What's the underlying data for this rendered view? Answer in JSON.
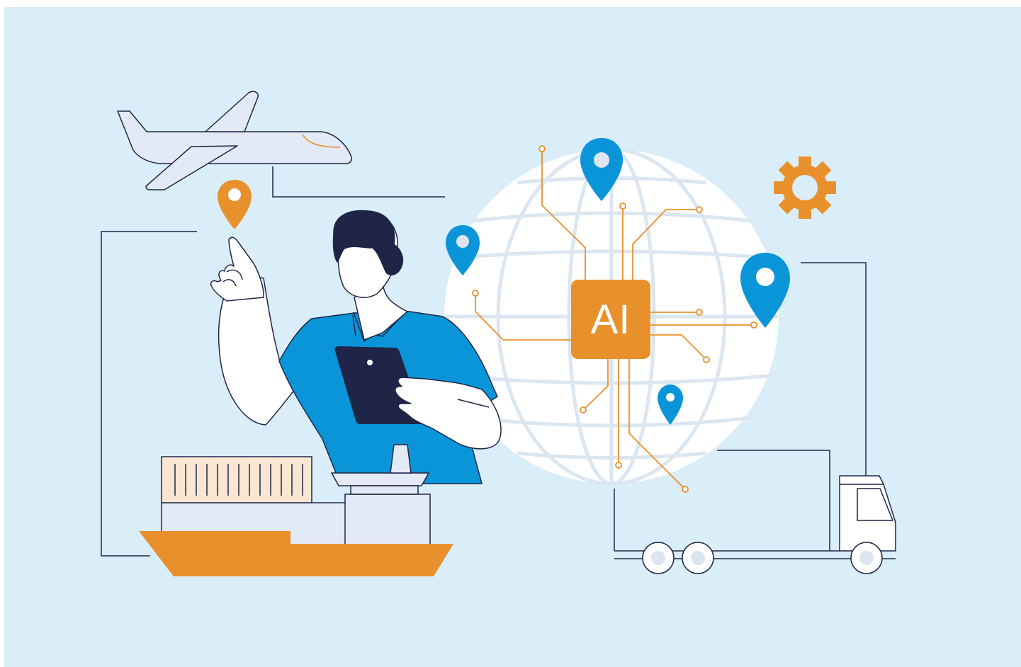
{
  "ai_chip": {
    "label": "AI"
  },
  "colors": {
    "background": "#d9eef9",
    "orange": "#e8912c",
    "blue": "#0a95d9",
    "navy": "#1f2547",
    "globe_fill": "#ffffff",
    "globe_grid": "#dce6f0"
  },
  "icons": [
    "airplane-icon",
    "location-pin-icon",
    "gear-icon",
    "cargo-ship-icon",
    "truck-icon",
    "tablet-icon",
    "globe-icon"
  ]
}
